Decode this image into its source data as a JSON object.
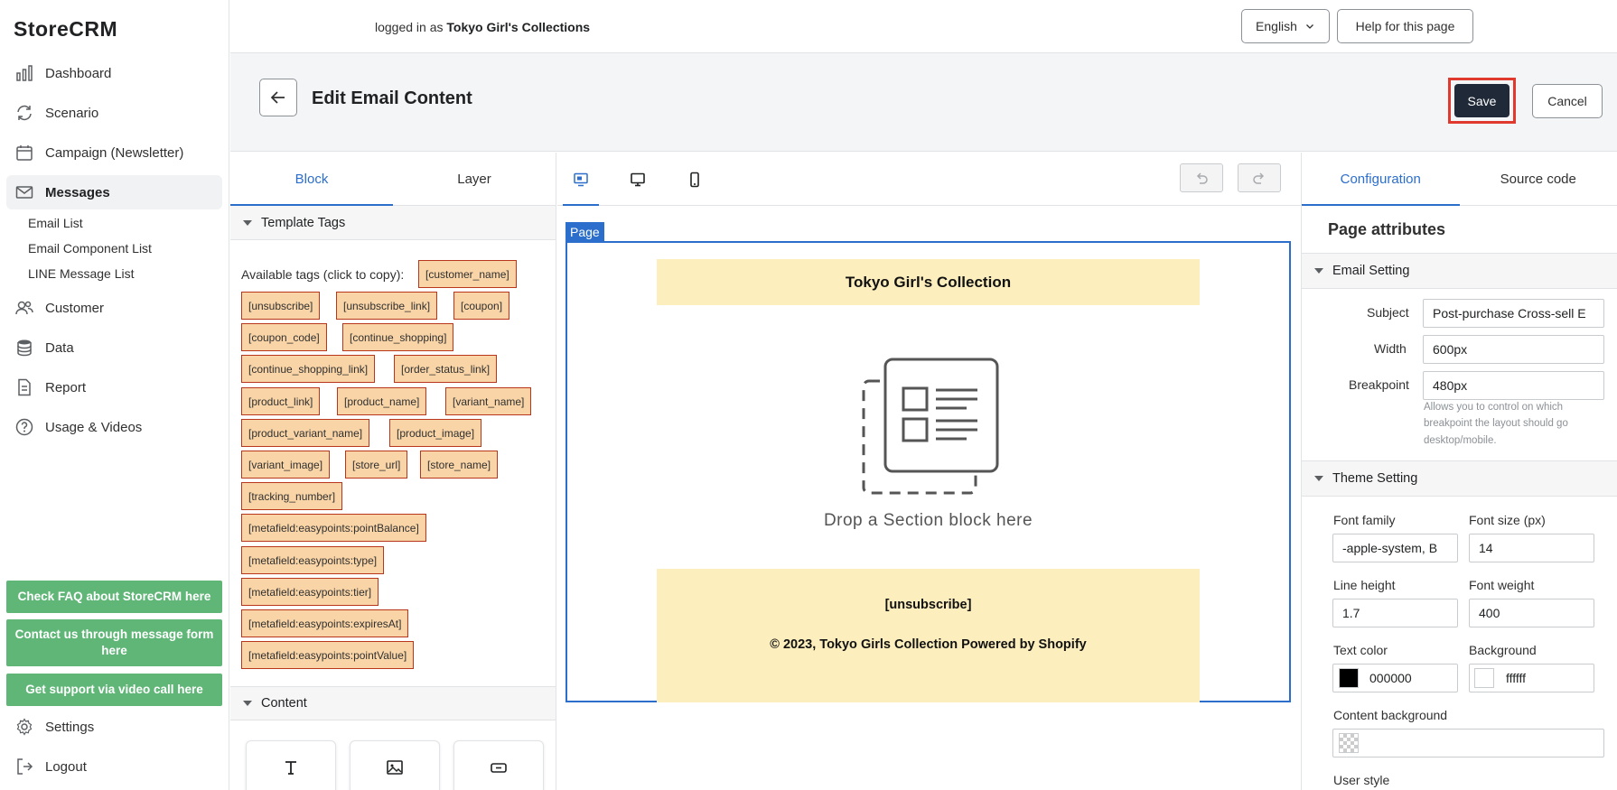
{
  "app": {
    "logo": "StoreCRM"
  },
  "sidebar": {
    "items": [
      {
        "label": "Dashboard"
      },
      {
        "label": "Scenario"
      },
      {
        "label": "Campaign (Newsletter)"
      },
      {
        "label": "Messages"
      },
      {
        "label": "Customer"
      },
      {
        "label": "Data"
      },
      {
        "label": "Report"
      },
      {
        "label": "Usage & Videos"
      },
      {
        "label": "Settings"
      },
      {
        "label": "Logout"
      }
    ],
    "sub_items": [
      "Email List",
      "Email Component List",
      "LINE Message List"
    ],
    "help_buttons": [
      "Check FAQ about StoreCRM here",
      "Contact us through message form here",
      "Get support via video call here"
    ]
  },
  "header": {
    "logged_in_prefix": "logged in as",
    "store_name": "Tokyo Girl's Collections",
    "language": "English",
    "help_label": "Help for this page"
  },
  "title_band": {
    "title": "Edit Email Content",
    "save_label": "Save",
    "cancel_label": "Cancel"
  },
  "left_panel": {
    "tabs": [
      "Block",
      "Layer"
    ],
    "template_tags_title": "Template Tags",
    "available_text": "Available tags (click to copy):",
    "tags": [
      "[customer_name]",
      "[unsubscribe]",
      "[unsubscribe_link]",
      "[coupon]",
      "[coupon_code]",
      "[continue_shopping]",
      "[continue_shopping_link]",
      "[order_status_link]",
      "[product_link]",
      "[product_name]",
      "[variant_name]",
      "[product_variant_name]",
      "[product_image]",
      "[variant_image]",
      "[store_url]",
      "[store_name]",
      "[tracking_number]",
      "[metafield:easypoints:pointBalance]",
      "[metafield:easypoints:type]",
      "[metafield:easypoints:tier]",
      "[metafield:easypoints:expiresAt]",
      "[metafield:easypoints:pointValue]"
    ],
    "content_title": "Content"
  },
  "canvas": {
    "page_label": "Page",
    "header_text": "Tokyo Girl's Collection",
    "drop_text": "Drop a Section block here",
    "footer_unsubscribe": "[unsubscribe]",
    "footer_copyright": "© 2023, Tokyo Girls Collection Powered by Shopify"
  },
  "right_panel": {
    "tabs": [
      "Configuration",
      "Source code"
    ],
    "title": "Page attributes",
    "email_setting": {
      "title": "Email Setting",
      "subject_label": "Subject",
      "subject_value": "Post-purchase Cross-sell E",
      "width_label": "Width",
      "width_value": "600px",
      "breakpoint_label": "Breakpoint",
      "breakpoint_value": "480px",
      "hint": "Allows you to control on which breakpoint the layout should go desktop/mobile."
    },
    "theme_setting": {
      "title": "Theme Setting",
      "font_family_label": "Font family",
      "font_family_value": "-apple-system, B",
      "font_size_label": "Font size (px)",
      "font_size_value": "14",
      "line_height_label": "Line height",
      "line_height_value": "1.7",
      "font_weight_label": "Font weight",
      "font_weight_value": "400",
      "text_color_label": "Text color",
      "text_color_value": "000000",
      "background_label": "Background",
      "background_value": "ffffff",
      "content_bg_label": "Content background",
      "user_style_label": "User style"
    }
  },
  "colors": {
    "accent": "#2c6ecb",
    "save": "#1f2937",
    "highlight": "#e03a2f",
    "help_button": "#5fb677",
    "tag_bg": "#f9d4a6",
    "email_band": "#fdefbd"
  }
}
